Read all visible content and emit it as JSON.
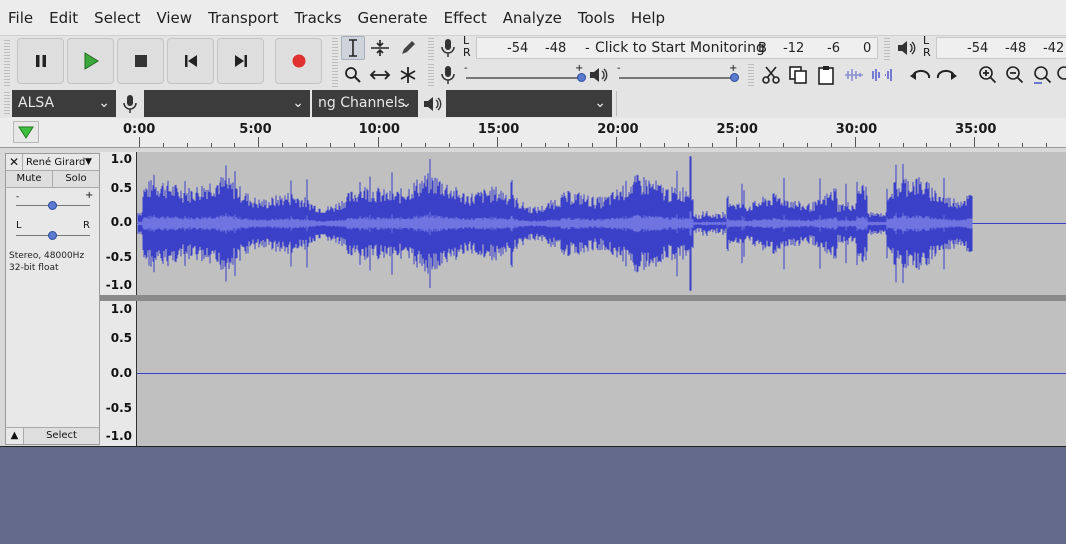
{
  "menu": [
    "File",
    "Edit",
    "Select",
    "View",
    "Transport",
    "Tracks",
    "Generate",
    "Effect",
    "Analyze",
    "Tools",
    "Help"
  ],
  "record_meter": {
    "lr": "L\nR",
    "ticks": [
      "-54",
      "-48",
      "-"
    ],
    "prompt": "Click to Start Monitoring",
    "ticks_right": [
      "B",
      "-12",
      "-6",
      "0"
    ]
  },
  "playback_meter": {
    "lr": "L\nR",
    "ticks": [
      "-54",
      "-48",
      "-42"
    ]
  },
  "slider_marks": {
    "plus": "+",
    "minus": "-"
  },
  "device": {
    "host": "ALSA",
    "record_device": "",
    "channels": "ng Channels",
    "playback_device": ""
  },
  "ruler": {
    "labels": [
      "0:00",
      "5:00",
      "10:00",
      "15:00",
      "20:00",
      "25:00",
      "30:00",
      "35:00"
    ]
  },
  "track": {
    "close": "✕",
    "name": "René Girard",
    "mute": "Mute",
    "solo": "Solo",
    "gain_minus": "-",
    "gain_plus": "+",
    "pan_left": "L",
    "pan_right": "R",
    "info1": "Stereo, 48000Hz",
    "info2": "32-bit float",
    "collapse": "▲",
    "select": "Select",
    "scale": [
      "1.0",
      "0.5",
      "0.0",
      "-0.5",
      "-1.0"
    ]
  },
  "colors": {
    "wave": "#3a40c8",
    "wave_light": "#6f74e0",
    "accent": "#3a8a3a",
    "record": "#e03030"
  }
}
